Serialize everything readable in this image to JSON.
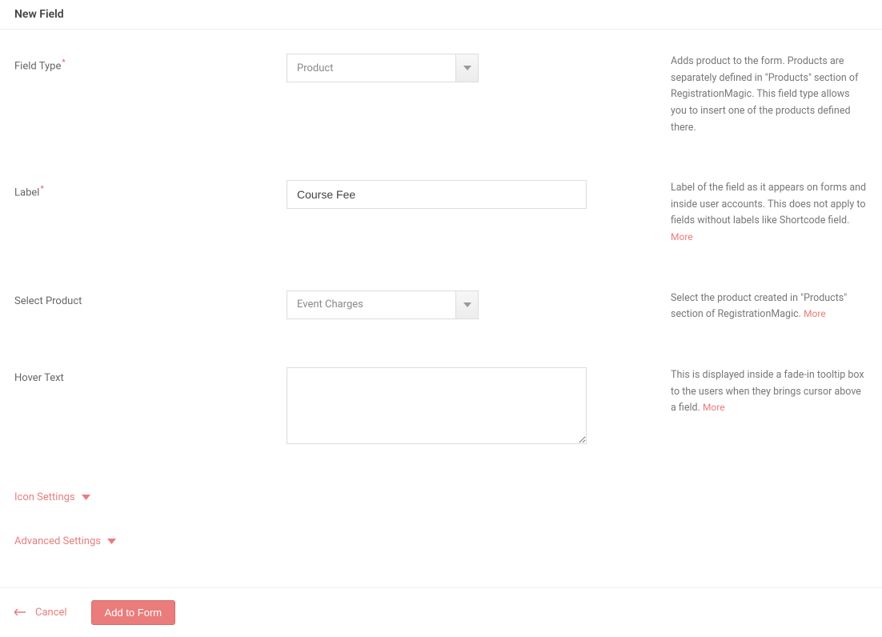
{
  "page": {
    "title": "New Field"
  },
  "fields": {
    "fieldType": {
      "label": "Field Type",
      "required": true,
      "value": "Product",
      "help": "Adds product to the form. Products are separately defined in \"Products\" section of RegistrationMagic. This field type allows you to insert one of the products defined there."
    },
    "label": {
      "label": "Label",
      "required": true,
      "value": "Course Fee",
      "help": "Label of the field as it appears on forms and inside user accounts. This does not apply to fields without labels like Shortcode field.",
      "moreLink": "More"
    },
    "selectProduct": {
      "label": "Select Product",
      "required": false,
      "value": "Event Charges",
      "help": "Select the product created in \"Products\" section of RegistrationMagic.",
      "moreLink": "More"
    },
    "hoverText": {
      "label": "Hover Text",
      "required": false,
      "value": "",
      "help": "This is displayed inside a fade-in tooltip box to the users when they brings cursor above a field.",
      "moreLink": "More"
    }
  },
  "sections": {
    "iconSettings": "Icon Settings",
    "advancedSettings": "Advanced Settings"
  },
  "footer": {
    "cancel": "Cancel",
    "submit": "Add to Form"
  }
}
